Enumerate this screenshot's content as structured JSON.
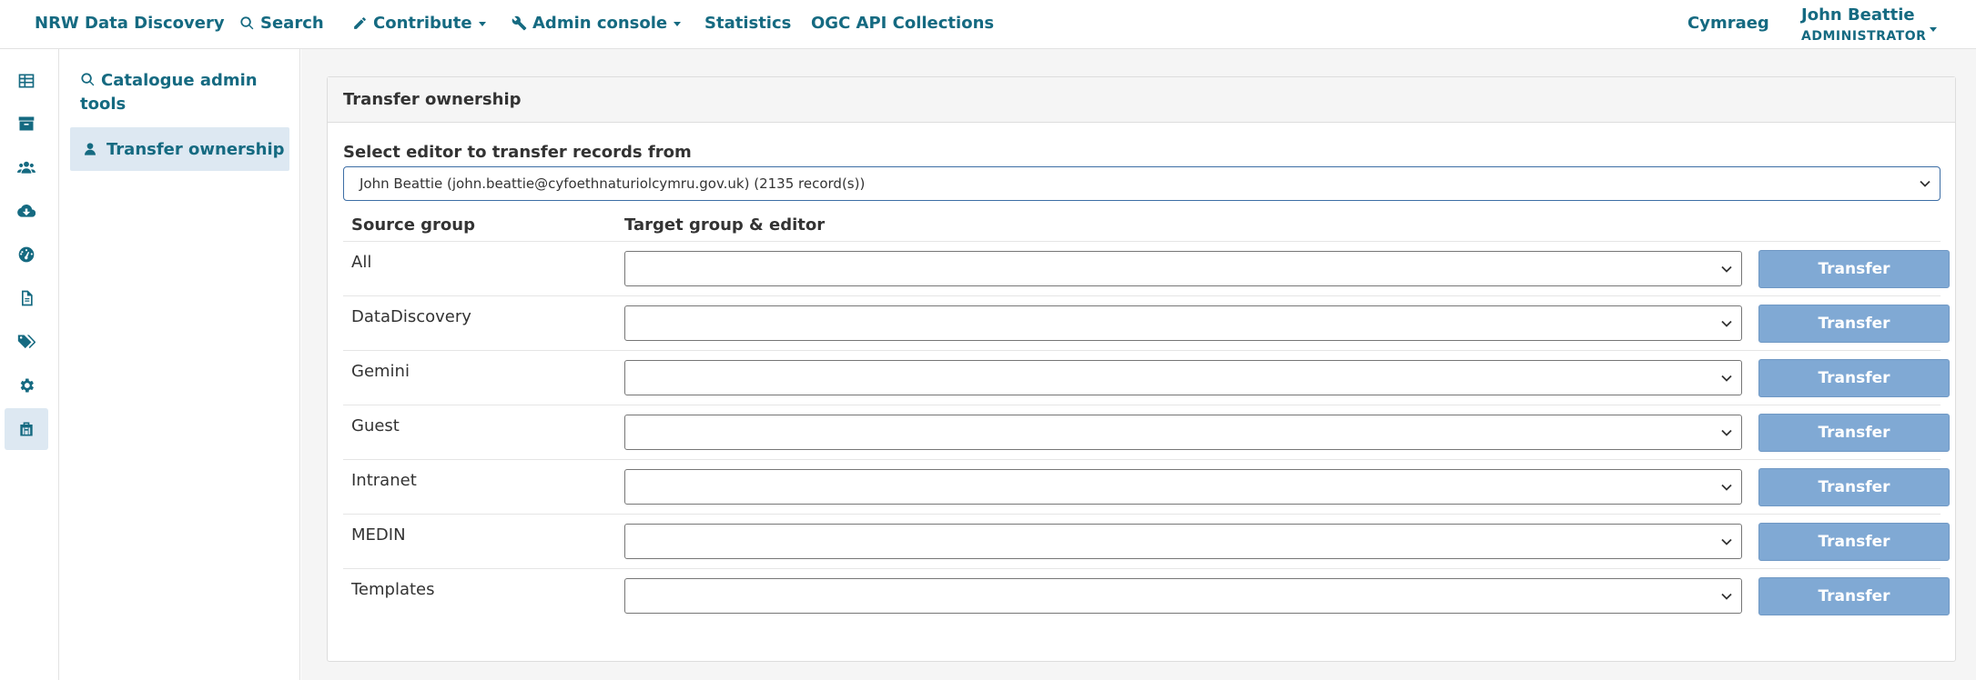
{
  "colors": {
    "brand": "#156a81",
    "button_disabled": "#80a9d4",
    "active_bg": "#dde8f2"
  },
  "nav": {
    "site_name": "NRW Data Discovery",
    "items": [
      {
        "label": "Search",
        "icon": "search-icon"
      },
      {
        "label": "Contribute",
        "icon": "pencil-icon",
        "dropdown": true
      },
      {
        "label": "Admin console",
        "icon": "wrench-icon",
        "dropdown": true
      },
      {
        "label": "Statistics"
      },
      {
        "label": "OGC API Collections"
      }
    ],
    "language": "Cymraeg",
    "user": {
      "name": "John Beattie",
      "role": "ADMINISTRATOR"
    }
  },
  "rail": {
    "icons": [
      "table-icon",
      "archive-icon",
      "users-icon",
      "cloud-download-icon",
      "dashboard-icon",
      "file-text-icon",
      "tags-icon",
      "gear-icon",
      "toolbox-icon"
    ],
    "active": "toolbox-icon"
  },
  "sidebar": {
    "title": "Catalogue admin tools",
    "active_item": "Transfer ownership"
  },
  "panel": {
    "title": "Transfer ownership",
    "editor_label": "Select editor to transfer records from",
    "editor_selected": "John Beattie (john.beattie@cyfoethnaturiolcymru.gov.uk) (2135 record(s))",
    "columns": {
      "source": "Source group",
      "target": "Target group & editor"
    },
    "transfer_label": "Transfer",
    "rows": [
      {
        "group": "All",
        "target": ""
      },
      {
        "group": "DataDiscovery",
        "target": ""
      },
      {
        "group": "Gemini",
        "target": ""
      },
      {
        "group": "Guest",
        "target": ""
      },
      {
        "group": "Intranet",
        "target": ""
      },
      {
        "group": "MEDIN",
        "target": ""
      },
      {
        "group": "Templates",
        "target": ""
      }
    ]
  }
}
